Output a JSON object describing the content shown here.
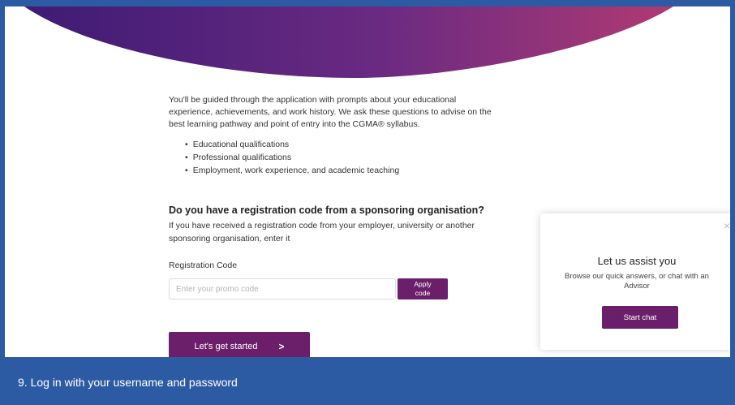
{
  "intro": {
    "paragraph": "You'll be guided through the application with prompts about your educational experience, achievements, and work history. We ask these questions to advise on the best learning pathway and point of entry into the CGMA® syllabus."
  },
  "qualifications": [
    "Educational qualifications",
    "Professional qualifications",
    "Employment, work experience, and academic teaching"
  ],
  "registration": {
    "heading": "Do you have a registration code from a sponsoring organisation?",
    "description": "If you have received a registration code from your employer, university or another sponsoring organisation, enter it",
    "label": "Registration Code",
    "input_value": "",
    "input_placeholder": "Enter your promo code",
    "apply_line1": "Apply",
    "apply_line2": "code"
  },
  "start_button": {
    "label": "Let's get started",
    "icon": "chevron-right-icon",
    "glyph": ">"
  },
  "chat": {
    "close_glyph": "×",
    "title": "Let us assist you",
    "description": "Browse our quick answers, or chat with an Advisor",
    "button": "Start chat"
  },
  "caption": "9. Log in with your username and password",
  "colors": {
    "brand_purple": "#6b1f6a",
    "frame_blue": "#2d5ba3",
    "gradient_start": "#3e1b74",
    "gradient_end": "#b03a72"
  }
}
